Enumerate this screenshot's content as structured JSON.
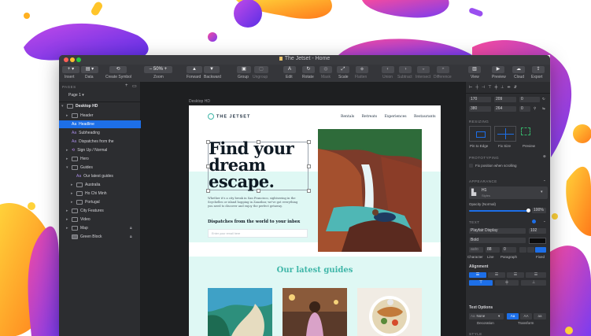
{
  "window": {
    "title": "The Jetset - Home"
  },
  "toolbar": {
    "insert": "Insert",
    "data": "Data",
    "create_symbol": "Create Symbol",
    "zoom_value": "50%",
    "zoom": "Zoom",
    "forward": "Forward",
    "backward": "Backward",
    "group": "Group",
    "ungroup": "Ungroup",
    "edit": "Edit",
    "rotate": "Rotate",
    "mask": "Mask",
    "scale": "Scale",
    "flatten": "Flatten",
    "union": "Union",
    "subtract": "Subtract",
    "intersect": "Intersect",
    "difference": "Difference",
    "view": "View",
    "preview": "Preview",
    "cloud": "Cloud",
    "export": "Export"
  },
  "layers": {
    "pages_label": "PAGES",
    "page": "Page 1",
    "artboard": "Desktop HD",
    "items": [
      {
        "label": "Header"
      },
      {
        "label": "Headline"
      },
      {
        "label": "Subheading"
      },
      {
        "label": "Dispatches from the"
      },
      {
        "label": "Sign Up / Normal"
      },
      {
        "label": "Hero"
      },
      {
        "label": "Guides"
      },
      {
        "label": "Our latest guides"
      },
      {
        "label": "Australia"
      },
      {
        "label": "Ho Chi Minh"
      },
      {
        "label": "Portugal"
      },
      {
        "label": "City Features"
      },
      {
        "label": "Video"
      },
      {
        "label": "Map"
      },
      {
        "label": "Green Block"
      }
    ]
  },
  "canvas": {
    "artboard_label": "Desktop HD"
  },
  "site": {
    "logo": "THE JETSET",
    "nav": [
      "Rentals",
      "Retreats",
      "Experiences",
      "Restaurants"
    ],
    "headline": [
      "Find your",
      "dream",
      "escape."
    ],
    "body": [
      "Whether it's a city break in San Francisco, sightseeing in the",
      "Seychelles or island hopping in Zanzibar, we've got everything",
      "you need to discover and enjoy the perfect getaway."
    ],
    "dispatch_heading": "Dispatches from the world to your inbox",
    "email_placeholder": "Enter your email here",
    "guides_heading": "Our latest guides"
  },
  "inspector": {
    "x": "170",
    "y": "209",
    "r": "0",
    "w": "380",
    "h": "264",
    "f": "0",
    "resizing": "RESIZING",
    "pin_to_edge": "Pin to Edge",
    "fix_size": "Fix Size",
    "resize_preview": "Preview",
    "prototyping": "PROTOTYPING",
    "fix_position": "Fix position when scrolling",
    "appearance": "APPEARANCE",
    "style_name": "H1",
    "style_sub": "Styles",
    "opacity_label": "Opacity (Normal)",
    "opacity_value": "100%",
    "opacity": 1.0,
    "text": "TEXT",
    "font": "Playfair Display",
    "font_size": "102",
    "weight": "Bold",
    "char": "auto",
    "line": "88",
    "para": "0",
    "char_label": "Character",
    "line_label": "Line",
    "para_label": "Paragraph",
    "fixed_label": "Fixed",
    "alignment": "Alignment",
    "text_options": "Text Options",
    "decoration_value": "None",
    "decoration": "Decoration",
    "transform": "Transform",
    "transform_aa1": "Aa",
    "transform_aa2": "AA",
    "transform_aa3": "aa",
    "style": "STYLE"
  },
  "colors": {
    "accent": "#1d6fe8",
    "mint": "#dff8f4",
    "teal": "#3fb6a8"
  }
}
